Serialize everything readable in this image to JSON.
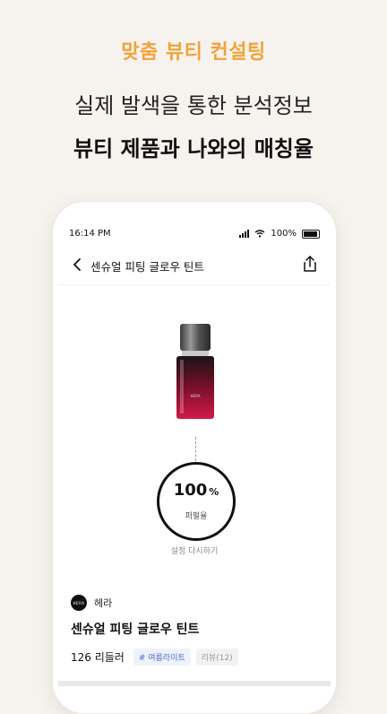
{
  "promo": {
    "kicker": "맞춤 뷰티 컨설팅",
    "line1": "실제 발색을 통한 분석정보",
    "line2": "뷰티 제품과 나와의 매칭율"
  },
  "status_bar": {
    "time": "16:14 PM",
    "battery": "100%"
  },
  "nav": {
    "title": "센슈얼 피팅 글로우 틴트"
  },
  "match": {
    "value": "100",
    "unit": "%",
    "label": "퍼펄율",
    "reset": "설정 다시하기"
  },
  "product": {
    "brand": "헤라",
    "brand_logo_text": "HERA",
    "name": "센슈얼 피팅 글로우 틴트",
    "price": "126 리들러",
    "tag": "# 여름라이트",
    "reviews": "리뷰(12)"
  },
  "colors": {
    "accent": "#f2a33a",
    "tag_blue": "#4b6fd0"
  }
}
